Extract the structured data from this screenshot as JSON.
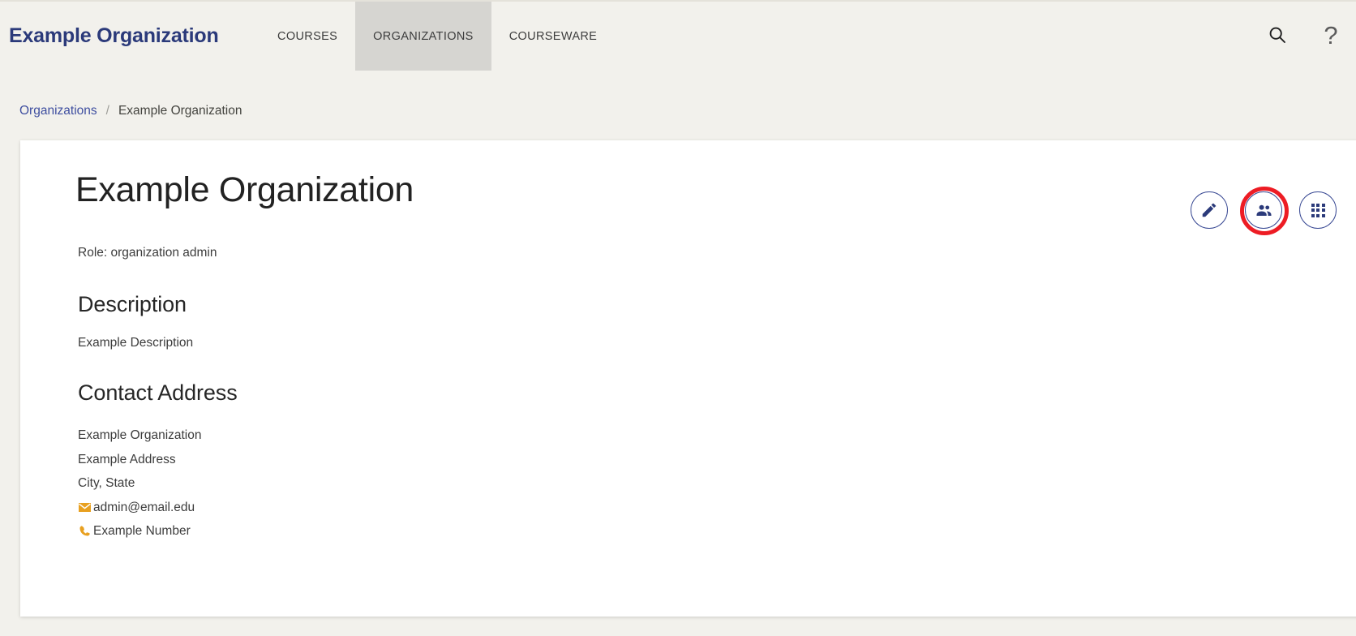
{
  "header": {
    "brand": "Example Organization",
    "tabs": [
      {
        "label": "COURSES",
        "active": false
      },
      {
        "label": "ORGANIZATIONS",
        "active": true
      },
      {
        "label": "COURSEWARE",
        "active": false
      }
    ],
    "search_icon": "search-icon",
    "help_label": "?"
  },
  "breadcrumb": {
    "parent": "Organizations",
    "separator": "/",
    "current": "Example Organization"
  },
  "organization": {
    "title": "Example Organization",
    "role": "Role: organization admin",
    "description_heading": "Description",
    "description": "Example Description",
    "contact_heading": "Contact Address",
    "address": {
      "name": "Example Organization",
      "street": "Example Address",
      "city_state": "City, State",
      "email": "admin@email.edu",
      "phone": "Example Number"
    }
  },
  "actions": {
    "edit_label": "edit",
    "members_label": "members",
    "grid_label": "apps"
  },
  "colors": {
    "brand_blue": "#2b3a7a",
    "link_blue": "#3f4fa0",
    "page_bg": "#f2f1ec",
    "active_tab_bg": "#d6d5d1",
    "highlight_red": "#ed1c24",
    "contact_icon_orange": "#e8a020"
  }
}
